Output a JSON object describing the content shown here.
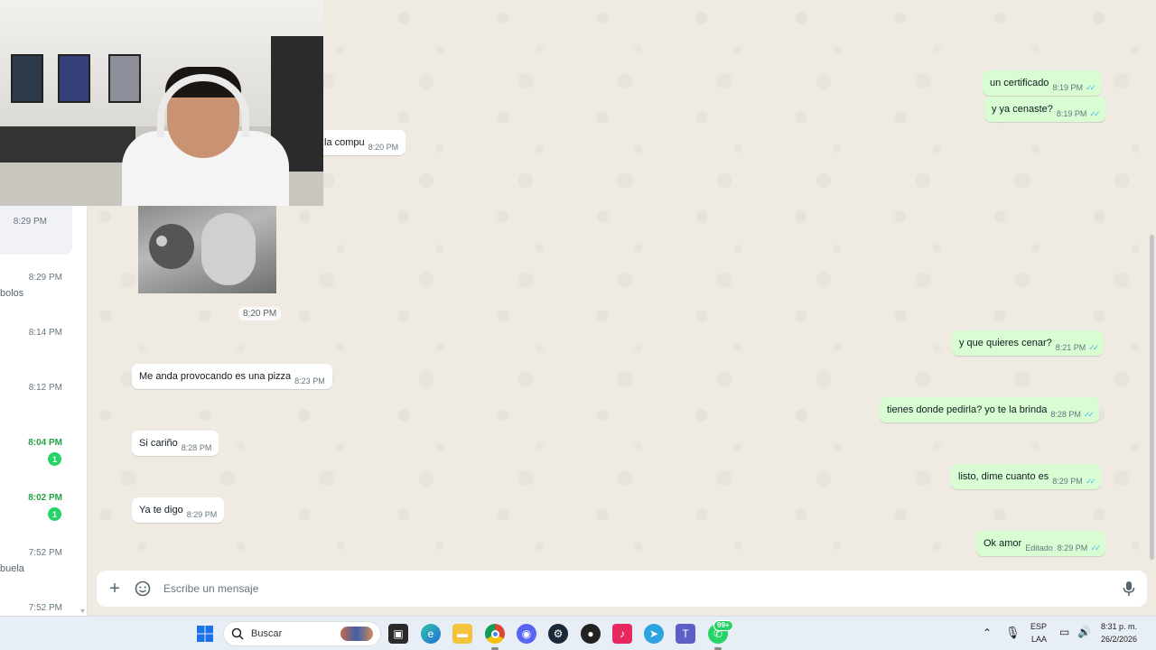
{
  "chat_list": {
    "items": [
      {
        "time": "8:29 PM",
        "preview": "",
        "badge": "",
        "unread": false,
        "active": true
      },
      {
        "time": "8:29 PM",
        "preview": "bolos",
        "badge": "",
        "unread": false,
        "active": false
      },
      {
        "time": "8:14 PM",
        "preview": "",
        "badge": "",
        "unread": false,
        "active": false
      },
      {
        "time": "8:12 PM",
        "preview": "",
        "badge": "",
        "unread": false,
        "active": false
      },
      {
        "time": "8:04 PM",
        "preview": "",
        "badge": "1",
        "unread": true,
        "active": false
      },
      {
        "time": "8:02 PM",
        "preview": "",
        "badge": "1",
        "unread": true,
        "active": false
      },
      {
        "time": "7:52 PM",
        "preview": "buela",
        "badge": "",
        "unread": false,
        "active": false
      },
      {
        "time": "7:52 PM",
        "preview": "",
        "badge": "",
        "unread": false,
        "active": false
      }
    ]
  },
  "messages": [
    {
      "dir": "out",
      "text": "un certificado",
      "time": "8:19 PM",
      "edited": ""
    },
    {
      "dir": "out",
      "text": "y ya cenaste?",
      "time": "8:19 PM",
      "edited": ""
    },
    {
      "dir": "in",
      "text": "la compu",
      "time": "8:20 PM",
      "edited": ""
    },
    {
      "dir": "in",
      "text": "Me anda provocando es una pizza",
      "time": "8:23 PM",
      "edited": ""
    },
    {
      "dir": "out",
      "text": "y que quieres cenar?",
      "time": "8:21 PM",
      "edited": ""
    },
    {
      "dir": "out",
      "text": "tienes donde pedirla? yo te la brinda",
      "time": "8:28 PM",
      "edited": ""
    },
    {
      "dir": "in",
      "text": "Si cariño",
      "time": "8:28 PM",
      "edited": ""
    },
    {
      "dir": "out",
      "text": "listo, dime cuanto es",
      "time": "8:29 PM",
      "edited": ""
    },
    {
      "dir": "in",
      "text": "Ya te digo",
      "time": "8:29 PM",
      "edited": ""
    },
    {
      "dir": "out",
      "text": "Ok amor",
      "time": "8:29 PM",
      "edited": "Editado"
    }
  ],
  "media": {
    "time": "8:20 PM"
  },
  "composer": {
    "placeholder": "Escribe un mensaje"
  },
  "icons": {
    "plus": "plus-icon",
    "sticker": "sticker-icon",
    "mic": "mic-icon",
    "ticks": "double-check-icon"
  },
  "colors": {
    "outgoing_bubble": "#d9fdd3",
    "incoming_bubble": "#ffffff",
    "wallpaper": "#efeae2",
    "unread_green": "#25d366",
    "read_ticks": "#53bdeb"
  },
  "taskbar": {
    "search_label": "Buscar",
    "whatsapp_badge": "99+",
    "language_top": "ESP",
    "language_bottom": "LAA",
    "clock_time": "8:31 p. m.",
    "clock_date": "26/2/2026"
  }
}
